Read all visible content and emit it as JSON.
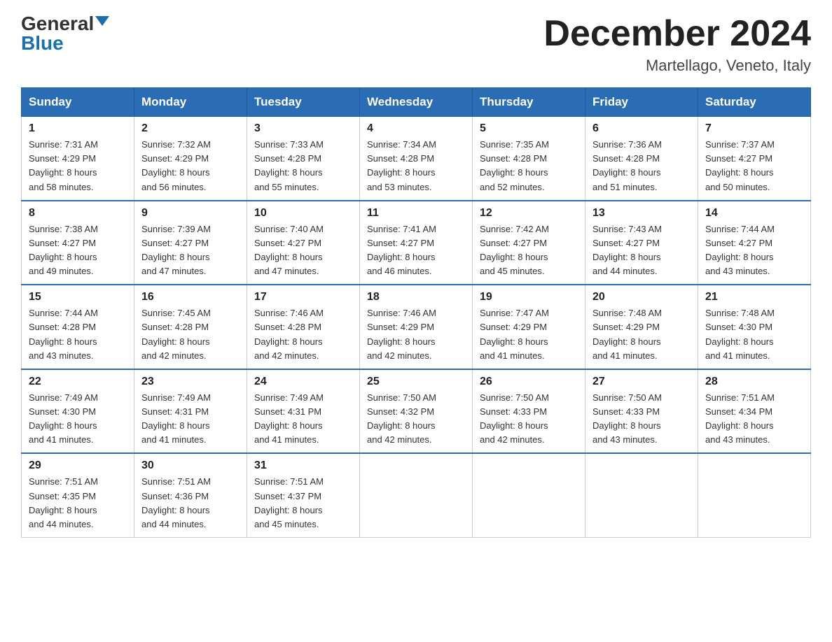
{
  "logo": {
    "general": "General",
    "blue": "Blue",
    "triangle": true
  },
  "title": "December 2024",
  "location": "Martellago, Veneto, Italy",
  "weekdays": [
    "Sunday",
    "Monday",
    "Tuesday",
    "Wednesday",
    "Thursday",
    "Friday",
    "Saturday"
  ],
  "weeks": [
    [
      {
        "day": "1",
        "info": "Sunrise: 7:31 AM\nSunset: 4:29 PM\nDaylight: 8 hours\nand 58 minutes."
      },
      {
        "day": "2",
        "info": "Sunrise: 7:32 AM\nSunset: 4:29 PM\nDaylight: 8 hours\nand 56 minutes."
      },
      {
        "day": "3",
        "info": "Sunrise: 7:33 AM\nSunset: 4:28 PM\nDaylight: 8 hours\nand 55 minutes."
      },
      {
        "day": "4",
        "info": "Sunrise: 7:34 AM\nSunset: 4:28 PM\nDaylight: 8 hours\nand 53 minutes."
      },
      {
        "day": "5",
        "info": "Sunrise: 7:35 AM\nSunset: 4:28 PM\nDaylight: 8 hours\nand 52 minutes."
      },
      {
        "day": "6",
        "info": "Sunrise: 7:36 AM\nSunset: 4:28 PM\nDaylight: 8 hours\nand 51 minutes."
      },
      {
        "day": "7",
        "info": "Sunrise: 7:37 AM\nSunset: 4:27 PM\nDaylight: 8 hours\nand 50 minutes."
      }
    ],
    [
      {
        "day": "8",
        "info": "Sunrise: 7:38 AM\nSunset: 4:27 PM\nDaylight: 8 hours\nand 49 minutes."
      },
      {
        "day": "9",
        "info": "Sunrise: 7:39 AM\nSunset: 4:27 PM\nDaylight: 8 hours\nand 47 minutes."
      },
      {
        "day": "10",
        "info": "Sunrise: 7:40 AM\nSunset: 4:27 PM\nDaylight: 8 hours\nand 47 minutes."
      },
      {
        "day": "11",
        "info": "Sunrise: 7:41 AM\nSunset: 4:27 PM\nDaylight: 8 hours\nand 46 minutes."
      },
      {
        "day": "12",
        "info": "Sunrise: 7:42 AM\nSunset: 4:27 PM\nDaylight: 8 hours\nand 45 minutes."
      },
      {
        "day": "13",
        "info": "Sunrise: 7:43 AM\nSunset: 4:27 PM\nDaylight: 8 hours\nand 44 minutes."
      },
      {
        "day": "14",
        "info": "Sunrise: 7:44 AM\nSunset: 4:27 PM\nDaylight: 8 hours\nand 43 minutes."
      }
    ],
    [
      {
        "day": "15",
        "info": "Sunrise: 7:44 AM\nSunset: 4:28 PM\nDaylight: 8 hours\nand 43 minutes."
      },
      {
        "day": "16",
        "info": "Sunrise: 7:45 AM\nSunset: 4:28 PM\nDaylight: 8 hours\nand 42 minutes."
      },
      {
        "day": "17",
        "info": "Sunrise: 7:46 AM\nSunset: 4:28 PM\nDaylight: 8 hours\nand 42 minutes."
      },
      {
        "day": "18",
        "info": "Sunrise: 7:46 AM\nSunset: 4:29 PM\nDaylight: 8 hours\nand 42 minutes."
      },
      {
        "day": "19",
        "info": "Sunrise: 7:47 AM\nSunset: 4:29 PM\nDaylight: 8 hours\nand 41 minutes."
      },
      {
        "day": "20",
        "info": "Sunrise: 7:48 AM\nSunset: 4:29 PM\nDaylight: 8 hours\nand 41 minutes."
      },
      {
        "day": "21",
        "info": "Sunrise: 7:48 AM\nSunset: 4:30 PM\nDaylight: 8 hours\nand 41 minutes."
      }
    ],
    [
      {
        "day": "22",
        "info": "Sunrise: 7:49 AM\nSunset: 4:30 PM\nDaylight: 8 hours\nand 41 minutes."
      },
      {
        "day": "23",
        "info": "Sunrise: 7:49 AM\nSunset: 4:31 PM\nDaylight: 8 hours\nand 41 minutes."
      },
      {
        "day": "24",
        "info": "Sunrise: 7:49 AM\nSunset: 4:31 PM\nDaylight: 8 hours\nand 41 minutes."
      },
      {
        "day": "25",
        "info": "Sunrise: 7:50 AM\nSunset: 4:32 PM\nDaylight: 8 hours\nand 42 minutes."
      },
      {
        "day": "26",
        "info": "Sunrise: 7:50 AM\nSunset: 4:33 PM\nDaylight: 8 hours\nand 42 minutes."
      },
      {
        "day": "27",
        "info": "Sunrise: 7:50 AM\nSunset: 4:33 PM\nDaylight: 8 hours\nand 43 minutes."
      },
      {
        "day": "28",
        "info": "Sunrise: 7:51 AM\nSunset: 4:34 PM\nDaylight: 8 hours\nand 43 minutes."
      }
    ],
    [
      {
        "day": "29",
        "info": "Sunrise: 7:51 AM\nSunset: 4:35 PM\nDaylight: 8 hours\nand 44 minutes."
      },
      {
        "day": "30",
        "info": "Sunrise: 7:51 AM\nSunset: 4:36 PM\nDaylight: 8 hours\nand 44 minutes."
      },
      {
        "day": "31",
        "info": "Sunrise: 7:51 AM\nSunset: 4:37 PM\nDaylight: 8 hours\nand 45 minutes."
      },
      {
        "day": "",
        "info": ""
      },
      {
        "day": "",
        "info": ""
      },
      {
        "day": "",
        "info": ""
      },
      {
        "day": "",
        "info": ""
      }
    ]
  ]
}
